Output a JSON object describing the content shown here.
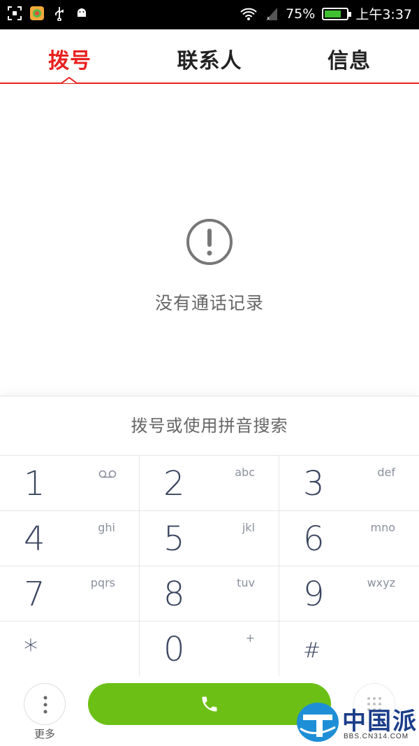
{
  "status_bar": {
    "battery_percent": "75%",
    "time": "上午3:37",
    "battery_level": 0.75,
    "icons": [
      "screenshot-icon",
      "app-icon",
      "usb-icon",
      "android-icon",
      "wifi-icon",
      "signal-icon",
      "battery-icon"
    ]
  },
  "tabs": [
    {
      "label": "拨号",
      "active": true
    },
    {
      "label": "联系人",
      "active": false
    },
    {
      "label": "信息",
      "active": false
    }
  ],
  "empty_state": {
    "icon": "alert-circle-icon",
    "text": "没有通话记录"
  },
  "dial": {
    "placeholder": "拨号或使用拼音搜索",
    "keys": [
      {
        "digit": "1",
        "letters": ""
      },
      {
        "digit": "2",
        "letters": "abc"
      },
      {
        "digit": "3",
        "letters": "def"
      },
      {
        "digit": "4",
        "letters": "ghi"
      },
      {
        "digit": "5",
        "letters": "jkl"
      },
      {
        "digit": "6",
        "letters": "mno"
      },
      {
        "digit": "7",
        "letters": "pqrs"
      },
      {
        "digit": "8",
        "letters": "tuv"
      },
      {
        "digit": "9",
        "letters": "wxyz"
      },
      {
        "digit": "*",
        "letters": ""
      },
      {
        "digit": "0",
        "letters": "+"
      },
      {
        "digit": "#",
        "letters": ""
      }
    ]
  },
  "bottom_bar": {
    "more_label": "更多",
    "call_icon": "phone-icon",
    "dialpad_icon": "dialpad-grid-icon"
  },
  "watermark": {
    "text": "中国派",
    "sub": "BBS.CN314.COM"
  },
  "colors": {
    "accent": "#e8211f",
    "call_green": "#6cc015",
    "digit": "#3b4660"
  }
}
